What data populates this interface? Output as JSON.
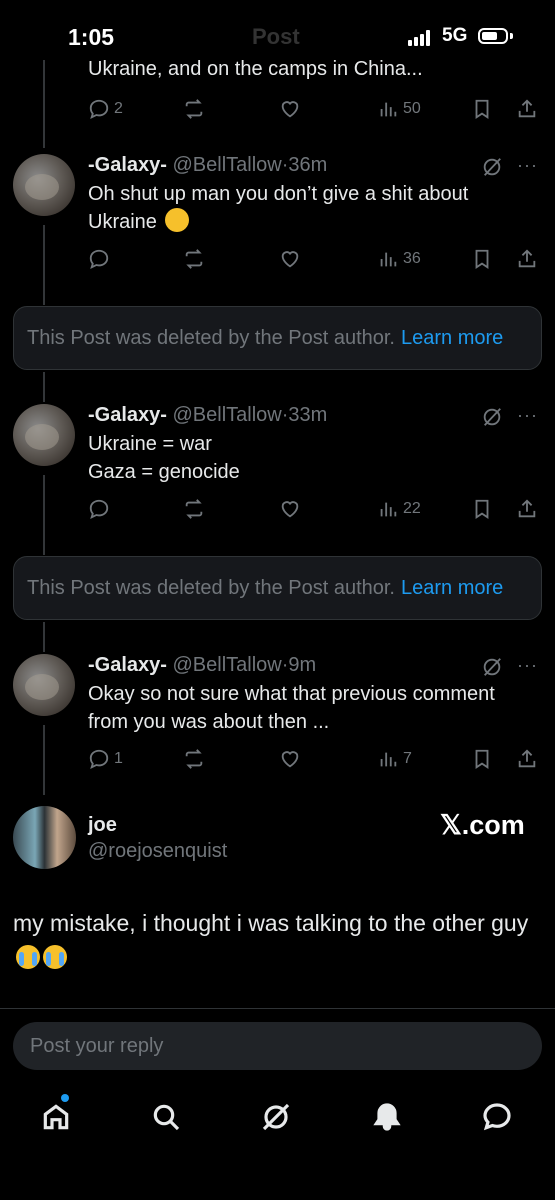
{
  "status_bar": {
    "time": "1:05",
    "network": "5G",
    "header_ghost": "Post"
  },
  "top_post": {
    "text_fragment": "Ukraine, and on the camps in China...",
    "replies": "2",
    "views": "50"
  },
  "replies": [
    {
      "name": "-Galaxy-",
      "handle": "@BellTallow",
      "time": "36m",
      "line1": "Oh shut up man you don’t give a shit about",
      "line2": "Ukraine",
      "emoji": "rofl-emoji",
      "replies": "",
      "views": "36"
    },
    {
      "name": "-Galaxy-",
      "handle": "@BellTallow",
      "time": "33m",
      "line1": "Ukraine = war",
      "line2": "Gaza = genocide",
      "replies": "",
      "views": "22"
    },
    {
      "name": "-Galaxy-",
      "handle": "@BellTallow",
      "time": "9m",
      "line1": "Okay so not sure what that previous comment",
      "line2": "from you was about then ...",
      "replies": "1",
      "views": "7"
    }
  ],
  "deleted_notice": {
    "text": "This Post was deleted by the Post author.",
    "link": "Learn more"
  },
  "quoted": {
    "name": "joe",
    "handle": "@roejosenquist",
    "watermark": "𝕏.com",
    "text": "my mistake, i thought i was talking to the other guy"
  },
  "reply_box": {
    "placeholder": "Post your reply"
  },
  "tab_bar": [
    "home-icon",
    "search-icon",
    "grok-icon",
    "notifications-icon",
    "messages-icon"
  ],
  "colors": {
    "accent": "#1d9bf0",
    "muted": "#71767b",
    "background": "#000000"
  }
}
